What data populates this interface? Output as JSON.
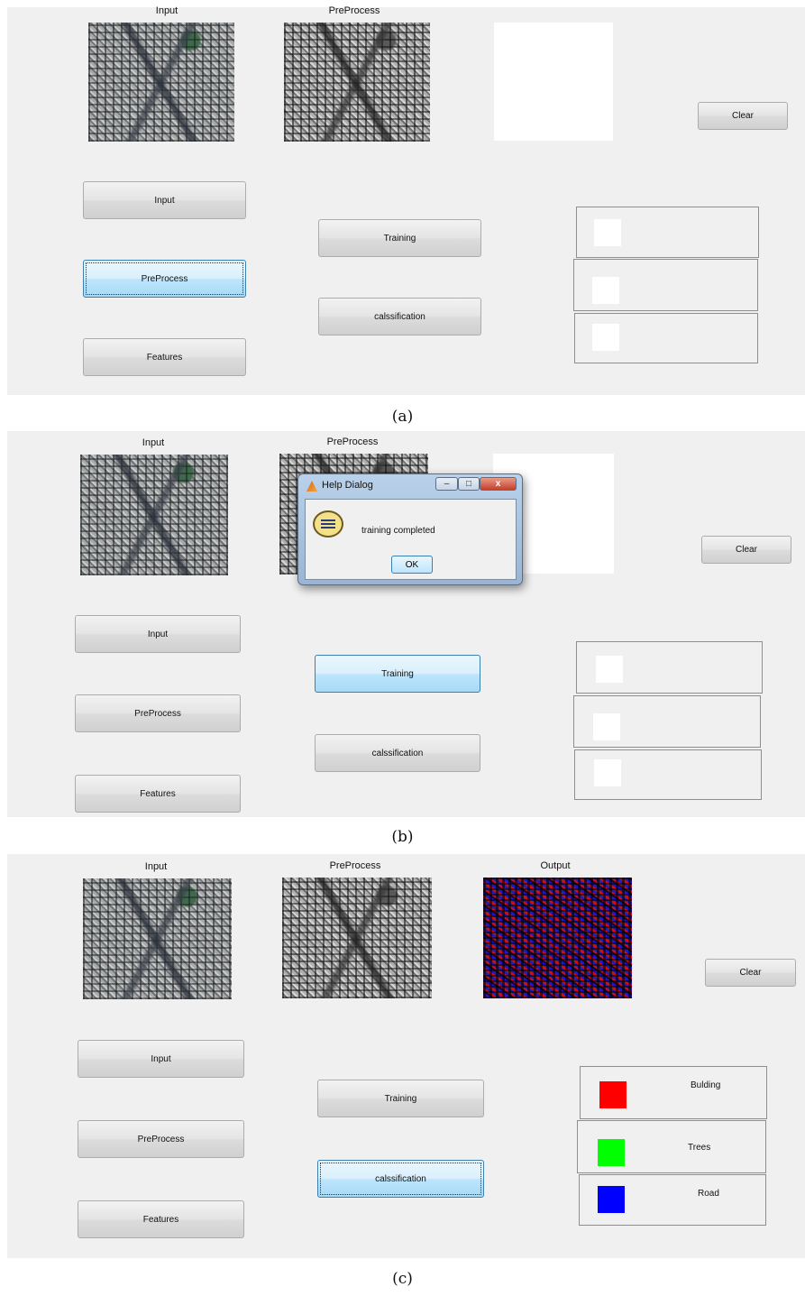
{
  "panels": [
    {
      "labels": {
        "input": "Input",
        "preprocess": "PreProcess"
      },
      "buttons": {
        "input": "Input",
        "preprocess": "PreProcess",
        "features": "Features",
        "training": "Training",
        "classification": "calssification",
        "clear": "Clear"
      },
      "caption": "(a)"
    },
    {
      "labels": {
        "input": "Input",
        "preprocess": "PreProcess"
      },
      "buttons": {
        "input": "Input",
        "preprocess": "PreProcess",
        "features": "Features",
        "training": "Training",
        "classification": "calssification",
        "clear": "Clear"
      },
      "dialog": {
        "title": "Help Dialog",
        "message": "training completed",
        "ok": "OK",
        "minimize": "–",
        "maximize": "□",
        "close": "x"
      },
      "caption": "(b)"
    },
    {
      "labels": {
        "input": "Input",
        "preprocess": "PreProcess",
        "output": "Output"
      },
      "buttons": {
        "input": "Input",
        "preprocess": "PreProcess",
        "features": "Features",
        "training": "Training",
        "classification": "calssification",
        "clear": "Clear"
      },
      "legend": [
        {
          "label": "Bulding",
          "color": "#ff0000"
        },
        {
          "label": "Trees",
          "color": "#00ff00"
        },
        {
          "label": "Road",
          "color": "#0000ff"
        }
      ],
      "caption": "(c)"
    }
  ]
}
